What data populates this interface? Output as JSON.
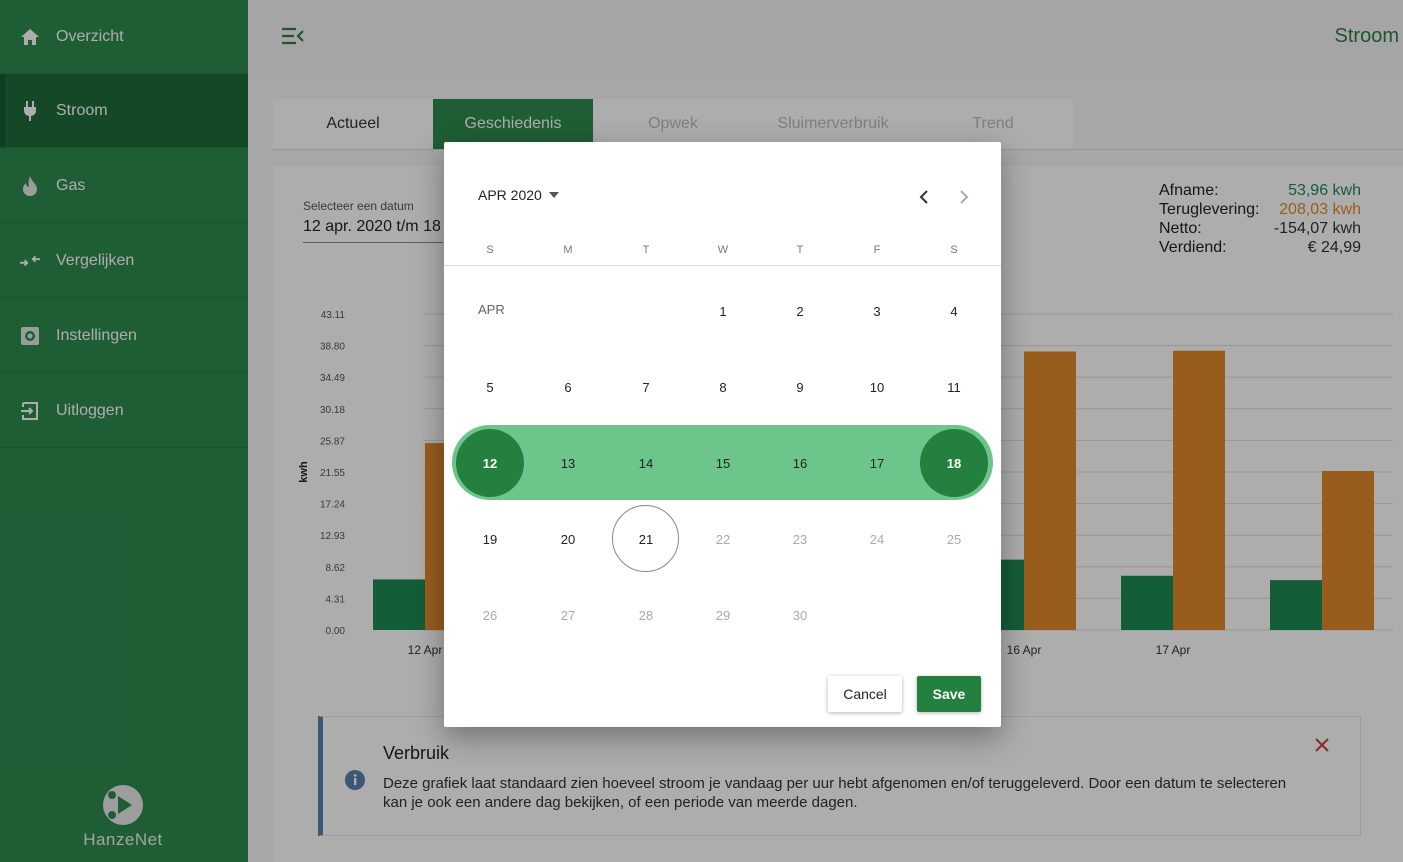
{
  "colors": {
    "sidebar": "#2e8b4f",
    "sidebar_active": "#1f6b3a",
    "primary": "#23803f",
    "range_band": "#6cc58b",
    "afname": "#1e8a55",
    "teruglevering": "#e08a2b",
    "info_accent": "#5b7fb0",
    "close": "#d23a3a"
  },
  "sidebar": {
    "items": [
      {
        "label": "Overzicht",
        "icon": "home-icon"
      },
      {
        "label": "Stroom",
        "icon": "plug-icon",
        "active": true
      },
      {
        "label": "Gas",
        "icon": "flame-icon"
      },
      {
        "label": "Vergelijken",
        "icon": "compare-arrows-icon"
      },
      {
        "label": "Instellingen",
        "icon": "settings-icon"
      },
      {
        "label": "Uitloggen",
        "icon": "logout-icon"
      }
    ],
    "logo_text": "HanzeNet"
  },
  "header": {
    "title": "Stroom",
    "menu_icon": "menu-collapse-icon"
  },
  "tabs": [
    {
      "label": "Actueel"
    },
    {
      "label": "Geschiedenis",
      "active": true
    },
    {
      "label": "Opwek",
      "disabled": true
    },
    {
      "label": "Sluimerverbruik",
      "disabled": true
    },
    {
      "label": "Trend",
      "disabled": true
    }
  ],
  "date_picker": {
    "label": "Selecteer een datum",
    "value": "12 apr. 2020 t/m 18"
  },
  "summary": {
    "rows": [
      {
        "label": "Afname:",
        "value": "53,96 kwh"
      },
      {
        "label": "Teruglevering:",
        "value": "208,03 kwh"
      },
      {
        "label": "Netto:",
        "value": "-154,07 kwh"
      },
      {
        "label": "Verdiend:",
        "value": "€ 24,99"
      }
    ]
  },
  "chart_data": {
    "type": "bar",
    "ylabel": "kwh",
    "y_ticks": [
      "0.00",
      "4.31",
      "8.62",
      "12.93",
      "17.24",
      "21.55",
      "25.87",
      "30.18",
      "34.49",
      "38.80",
      "43.11"
    ],
    "ylim": [
      0,
      43.11
    ],
    "grid": true,
    "categories_visible": [
      "12 Apr",
      "16 Apr",
      "17 Apr"
    ],
    "series": [
      {
        "name": "Afname",
        "color": "#1e8a55",
        "points": [
          {
            "x": "12 Apr",
            "y": 6.9
          },
          {
            "x": "16 Apr",
            "y": 9.6
          },
          {
            "x": "17 Apr",
            "y": 7.4
          },
          {
            "x": "18 Apr",
            "y": 6.8
          }
        ]
      },
      {
        "name": "Teruglevering",
        "color": "#e08a2b",
        "points": [
          {
            "x": "12 Apr",
            "y": 25.5
          },
          {
            "x": "16 Apr",
            "y": 38.0
          },
          {
            "x": "17 Apr",
            "y": 38.1
          },
          {
            "x": "18 Apr",
            "y": 21.7
          }
        ]
      }
    ]
  },
  "info": {
    "title": "Verbruik",
    "text": "Deze grafiek laat standaard zien hoeveel stroom je vandaag per uur hebt afgenomen en/of teruggeleverd. Door een datum te selecteren kan je ook een andere dag bekijken, of een periode van meerde dagen.",
    "icon": "info-icon",
    "close_icon": "close-icon"
  },
  "dialog": {
    "month_year": "APR 2020",
    "weekdays": [
      "S",
      "M",
      "T",
      "W",
      "T",
      "F",
      "S"
    ],
    "month_label": "APR",
    "weeks": [
      [
        "",
        "",
        "",
        "1",
        "2",
        "3",
        "4"
      ],
      [
        "5",
        "6",
        "7",
        "8",
        "9",
        "10",
        "11"
      ],
      [
        "12",
        "13",
        "14",
        "15",
        "16",
        "17",
        "18"
      ],
      [
        "19",
        "20",
        "21",
        "22",
        "23",
        "24",
        "25"
      ],
      [
        "26",
        "27",
        "28",
        "29",
        "30",
        "",
        ""
      ]
    ],
    "range_start": "12",
    "range_end": "18",
    "today": "21",
    "cancel_label": "Cancel",
    "save_label": "Save"
  }
}
